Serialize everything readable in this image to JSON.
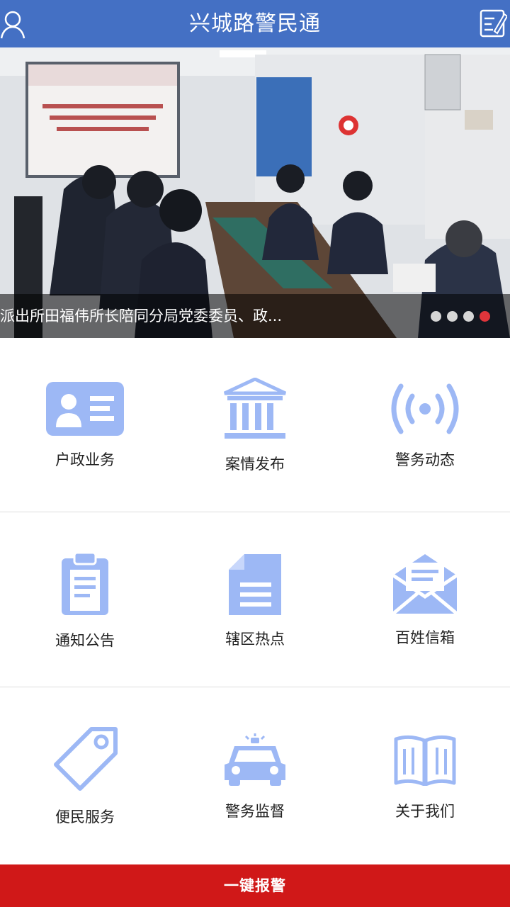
{
  "header": {
    "title": "兴城路警民通",
    "user_icon": "user-icon",
    "edit_icon": "edit-icon"
  },
  "banner": {
    "caption": "派出所田福伟所长陪同分局党委委员、政...",
    "slide_count": 4,
    "active_slide": 4
  },
  "menu": [
    {
      "label": "户政业务",
      "icon": "id-card-icon"
    },
    {
      "label": "案情发布",
      "icon": "bank-building-icon"
    },
    {
      "label": "警务动态",
      "icon": "broadcast-icon"
    },
    {
      "label": "通知公告",
      "icon": "clipboard-icon"
    },
    {
      "label": "辖区热点",
      "icon": "document-icon"
    },
    {
      "label": "百姓信箱",
      "icon": "mail-icon"
    },
    {
      "label": "便民服务",
      "icon": "tag-icon"
    },
    {
      "label": "警务监督",
      "icon": "police-car-icon"
    },
    {
      "label": "关于我们",
      "icon": "book-icon"
    }
  ],
  "alarm_button": {
    "label": "一键报警"
  },
  "colors": {
    "header": "#4470c4",
    "icon": "#9db8f5",
    "alarm": "#d01818",
    "active_dot": "#e0353b"
  }
}
